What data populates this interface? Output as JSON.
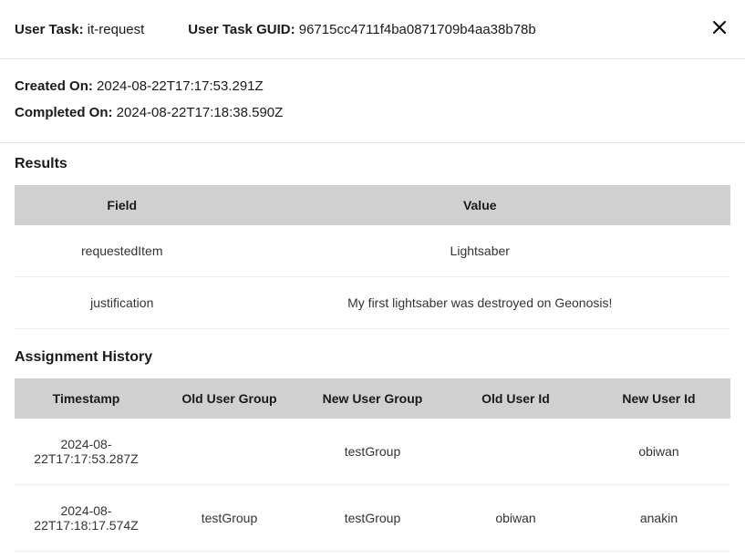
{
  "header": {
    "task_label": "User Task:",
    "task_value": "it-request",
    "guid_label": "User Task GUID:",
    "guid_value": "96715cc4711f4ba0871709b4aa38b78b"
  },
  "meta": {
    "created_label": "Created On:",
    "created_value": "2024-08-22T17:17:53.291Z",
    "completed_label": "Completed On:",
    "completed_value": "2024-08-22T17:18:38.590Z"
  },
  "results": {
    "title": "Results",
    "headers": {
      "field": "Field",
      "value": "Value"
    },
    "rows": [
      {
        "field": "requestedItem",
        "value": "Lightsaber"
      },
      {
        "field": "justification",
        "value": "My first lightsaber was destroyed on Geonosis!"
      }
    ]
  },
  "history": {
    "title": "Assignment History",
    "headers": {
      "timestamp": "Timestamp",
      "old_group": "Old User Group",
      "new_group": "New User Group",
      "old_user": "Old User Id",
      "new_user": "New User Id"
    },
    "rows": [
      {
        "timestamp": "2024-08-22T17:17:53.287Z",
        "old_group": "",
        "new_group": "testGroup",
        "old_user": "",
        "new_user": "obiwan"
      },
      {
        "timestamp": "2024-08-22T17:18:17.574Z",
        "old_group": "testGroup",
        "new_group": "testGroup",
        "old_user": "obiwan",
        "new_user": "anakin"
      }
    ]
  }
}
